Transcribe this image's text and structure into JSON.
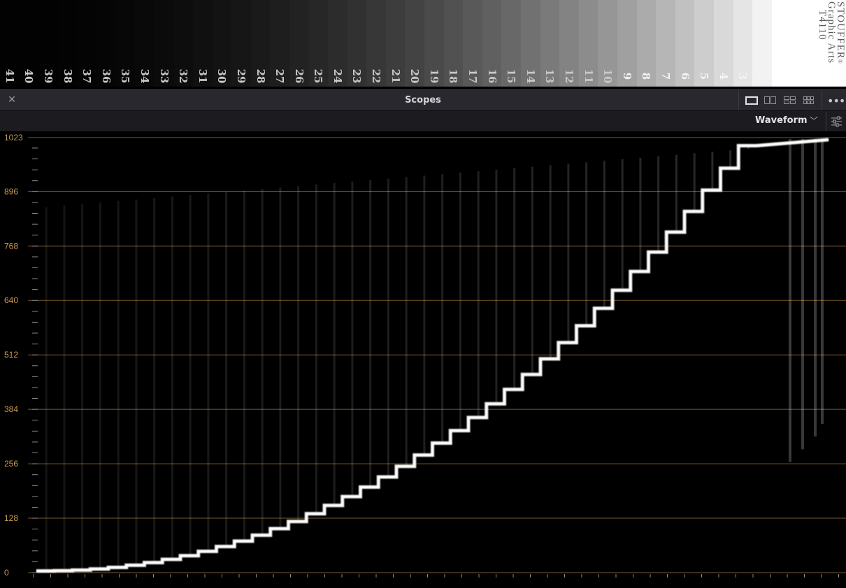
{
  "step_wedge": {
    "steps": [
      "41",
      "40",
      "39",
      "38",
      "37",
      "36",
      "35",
      "34",
      "33",
      "32",
      "31",
      "30",
      "29",
      "28",
      "27",
      "26",
      "25",
      "24",
      "23",
      "22",
      "21",
      "20",
      "19",
      "18",
      "17",
      "16",
      "15",
      "14",
      "13",
      "12",
      "11",
      "10",
      "9",
      "8",
      "7",
      "6",
      "5",
      "4",
      "3",
      "2"
    ],
    "brand": "STOUFFER",
    "brand_mark": "®",
    "line2": "Graphic Arts",
    "line3": "T4110"
  },
  "panel": {
    "title": "Scopes",
    "close_icon": "close-icon",
    "layout_icons": [
      "single-view-icon",
      "dual-view-icon",
      "quad-view-icon",
      "quad-wide-view-icon"
    ],
    "more_icon": "more-dots-icon",
    "scope_type": "Waveform",
    "settings_icon": "sliders-icon"
  },
  "waveform": {
    "y_ticks": [
      "1023",
      "896",
      "768",
      "640",
      "512",
      "384",
      "256",
      "128",
      "0"
    ],
    "tick_color": "#c89a55",
    "gridline_color": "#7a5a2c"
  }
}
